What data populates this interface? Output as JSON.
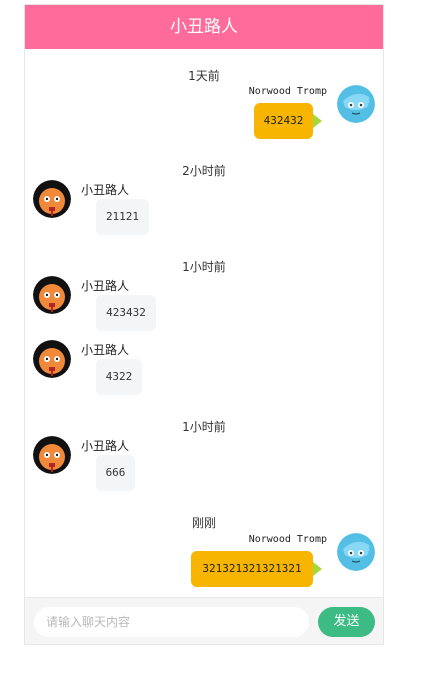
{
  "header": {
    "title": "小丑路人"
  },
  "messages": [
    {
      "time": "1天前",
      "side": "right",
      "name": "Norwood Tromp",
      "text": "432432"
    },
    {
      "time": "2小时前",
      "side": "left",
      "name": "小丑路人",
      "text": "21121"
    },
    {
      "time": "1小时前",
      "side": "left",
      "name": "小丑路人",
      "text": "423432"
    },
    {
      "time": "",
      "side": "left",
      "name": "小丑路人",
      "text": "4322"
    },
    {
      "time": "1小时前",
      "side": "left",
      "name": "小丑路人",
      "text": "666"
    },
    {
      "time": "刚刚",
      "side": "right",
      "name": "Norwood Tromp",
      "text": "321321321321321"
    }
  ],
  "footer": {
    "input_placeholder": "请输入聊天内容",
    "send_label": "发送"
  },
  "colors": {
    "header": "#ff6b9a",
    "right_bubble": "#f7b500",
    "send": "#3dbb84"
  }
}
